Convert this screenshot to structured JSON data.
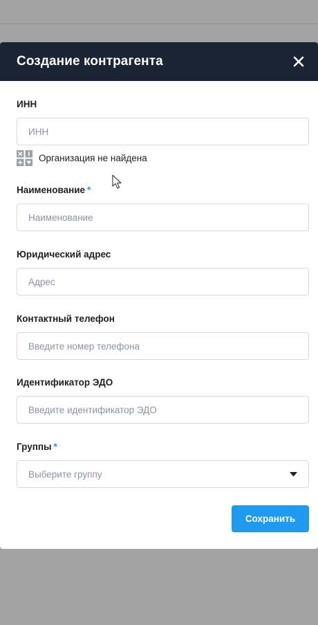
{
  "modal": {
    "title": "Создание контрагента"
  },
  "form": {
    "inn": {
      "label": "ИНН",
      "placeholder": "ИНН",
      "value": ""
    },
    "lookup_status": "Организация не найдена",
    "name": {
      "label": "Наименование",
      "required_mark": "*",
      "placeholder": "Наименование",
      "value": ""
    },
    "address": {
      "label": "Юридический адрес",
      "placeholder": "Адрес",
      "value": ""
    },
    "phone": {
      "label": "Контактный телефон",
      "placeholder": "Введите номер телефона",
      "value": ""
    },
    "edo": {
      "label": "Идентификатор ЭДО",
      "placeholder": "Введите идентификатор ЭДО",
      "value": ""
    },
    "groups": {
      "label": "Группы",
      "required_mark": "*",
      "placeholder": "Выберите группу"
    }
  },
  "actions": {
    "save_label": "Сохранить"
  },
  "colors": {
    "header_bg": "#1b2434",
    "accent": "#1e9bf0",
    "overlay": "#a3a3a3"
  },
  "icons": {
    "close": "close-icon",
    "status": "not-found-icon",
    "select_arrow": "caret-down-icon",
    "cursor": "mouse-pointer-icon"
  }
}
